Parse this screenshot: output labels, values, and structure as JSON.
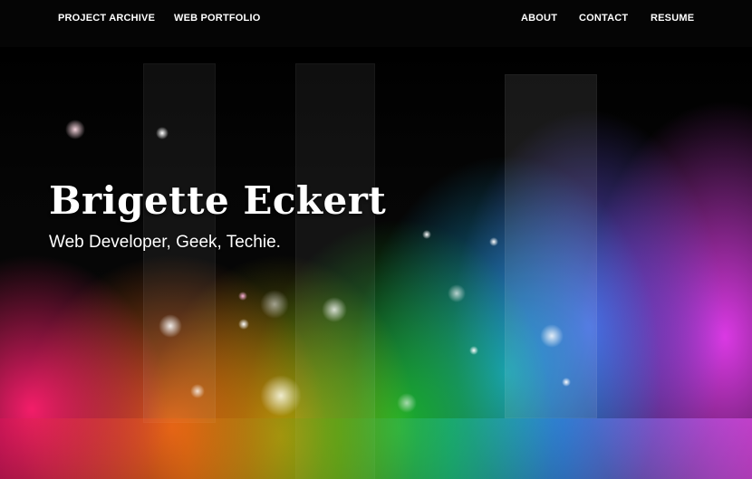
{
  "nav": {
    "left": [
      {
        "label": "PROJECT ARCHIVE"
      },
      {
        "label": "WEB PORTFOLIO"
      }
    ],
    "right": [
      {
        "label": "ABOUT"
      },
      {
        "label": "CONTACT"
      },
      {
        "label": "RESUME"
      }
    ]
  },
  "hero": {
    "name": "Brigette Eckert",
    "tagline": "Web Developer, Geek, Techie."
  },
  "colors": {
    "navbar_bg": "#050505",
    "text": "#ffffff"
  }
}
